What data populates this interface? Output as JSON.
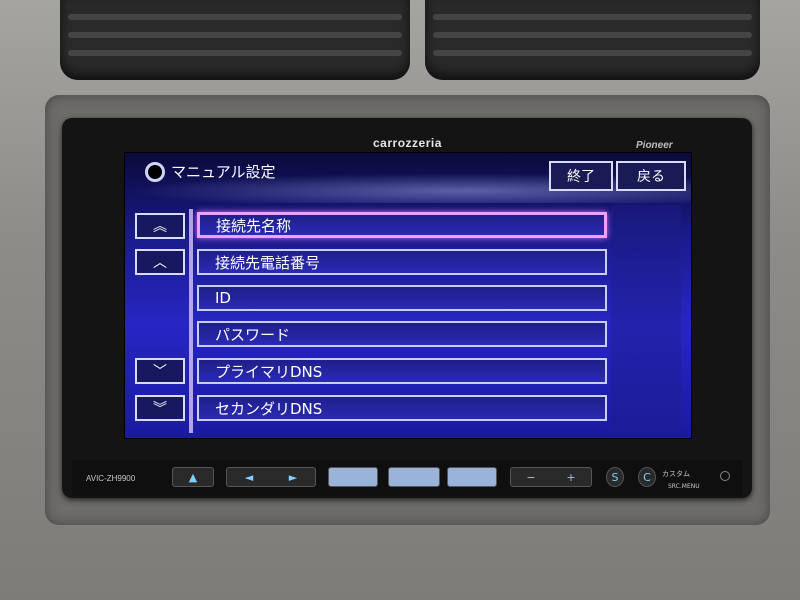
{
  "device": {
    "brand": "carrozzeria",
    "maker": "Pioneer",
    "model": "AVIC-ZH9900"
  },
  "screen": {
    "title": "マニュアル設定",
    "buttons": {
      "end": "終了",
      "back": "戻る"
    },
    "side_controls": {
      "page_up": "︽",
      "up": "︿",
      "down": "﹀",
      "page_down": "︾"
    },
    "items": [
      {
        "label": "接続先名称",
        "selected": true
      },
      {
        "label": "接続先電話番号",
        "selected": false
      },
      {
        "label": "ID",
        "selected": false
      },
      {
        "label": "パスワード",
        "selected": false
      },
      {
        "label": "プライマリDNS",
        "selected": false
      },
      {
        "label": "セカンダリDNS",
        "selected": false
      }
    ],
    "colors": {
      "screen_blue": "#2626c4",
      "selected_border": "#f0a0ff",
      "item_border": "#c9ceff"
    }
  },
  "controls": {
    "eject": "▲",
    "seek_left": "◄",
    "seek_right": "►",
    "vol_minus": "−",
    "vol_plus": "+",
    "s_button": "S",
    "c_button": "C",
    "custom_label": "カスタム",
    "src_menu_label": "SRC.MENU"
  }
}
